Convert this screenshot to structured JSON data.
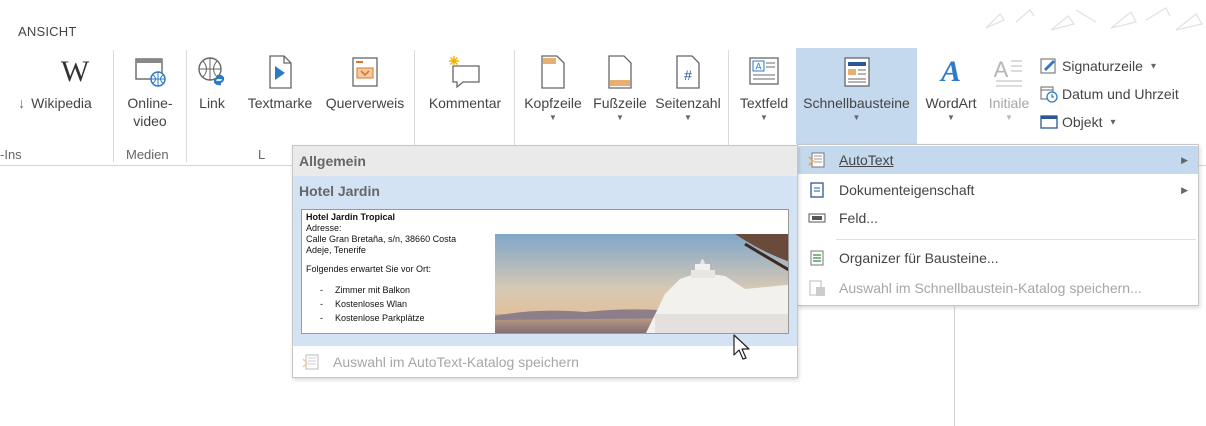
{
  "tabbar": {
    "tab_label": "ANSICHT"
  },
  "ribbon": {
    "buttons": [
      {
        "label": "Wikipedia",
        "prefix": "↓"
      },
      {
        "label": "Online-\nvideo"
      },
      {
        "label": "Link"
      },
      {
        "label": "Textmarke"
      },
      {
        "label": "Querverweis"
      },
      {
        "label": "Kommentar"
      },
      {
        "label": "Kopfzeile"
      },
      {
        "label": "Fußzeile"
      },
      {
        "label": "Seitenzahl"
      },
      {
        "label": "Textfeld"
      },
      {
        "label": "Schnellbausteine"
      },
      {
        "label": "WordArt"
      },
      {
        "label": "Initiale"
      }
    ],
    "small_buttons": [
      {
        "label": "Signaturzeile",
        "arrow": "▾"
      },
      {
        "label": "Datum und Uhrzeit"
      },
      {
        "label": "Objekt",
        "arrow": "▾"
      }
    ],
    "groups": [
      {
        "label": "-Ins"
      },
      {
        "label": "Medien"
      },
      {
        "label": "L"
      }
    ]
  },
  "menu": {
    "items": [
      {
        "label": "AutoText",
        "has_submenu": true,
        "highlighted": true,
        "icon": "autotext-icon"
      },
      {
        "label": "Dokumenteigenschaft",
        "has_submenu": true,
        "icon": "document-property-icon"
      },
      {
        "label": "Feld...",
        "icon": "field-icon"
      },
      {
        "label": "Organizer für Bausteine...",
        "icon": "organizer-icon"
      },
      {
        "label": "Auswahl im Schnellbaustein-Katalog speichern...",
        "disabled": true,
        "icon": "save-selection-icon"
      }
    ]
  },
  "gallery": {
    "category": "Allgemein",
    "item_title": "Hotel Jardin",
    "preview": {
      "heading": "Hotel Jardin Tropical",
      "address_label": "Adresse:",
      "address_line1": "Calle Gran Bretaña, s/n, 38660 Costa",
      "address_line2": "Adeje, Tenerife",
      "intro": "Folgendes erwartet Sie vor Ort:",
      "list": [
        "Zimmer mit Balkon",
        "Kostenloses Wlan",
        "Kostenlose Parkplätze"
      ]
    },
    "footer": "Auswahl im AutoText-Katalog speichern"
  },
  "colors": {
    "accent": "#2b579a",
    "highlight": "#c5d9ee",
    "gallery_item_bg": "#d4e3f3"
  }
}
